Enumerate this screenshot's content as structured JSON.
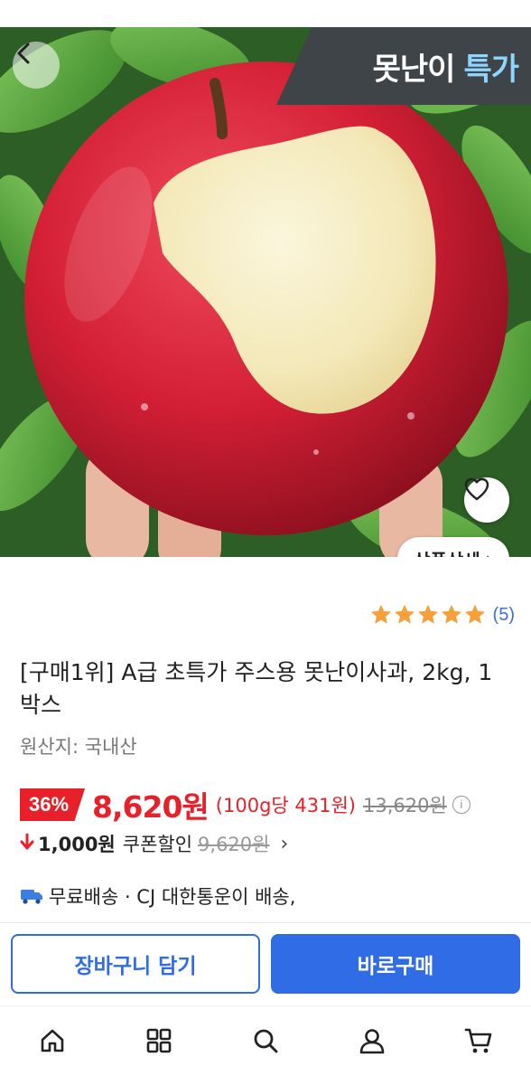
{
  "hero": {
    "banner_text_1": "못난이",
    "banner_text_2": "특가",
    "detail_button_label": "상품상세",
    "detail_button_chevron": "›"
  },
  "rating": {
    "stars": 5,
    "count": "(5)"
  },
  "product": {
    "title": "[구매1위] A급 초특가 주스용 못난이사과, 2kg, 1박스",
    "origin": "원산지: 국내산"
  },
  "price": {
    "discount": "36%",
    "sale_price": "8,620원",
    "unit_price": "(100g당 431원)",
    "original_price": "13,620원",
    "info_icon": "i"
  },
  "coupon": {
    "arrow": "🠗",
    "amount": "1,000원",
    "label": "쿠폰할인",
    "final_price": "9,620원",
    "chevron": "›"
  },
  "shipping": {
    "text": "무료배송 · CJ 대한통운이 배송,"
  },
  "actions": {
    "cart_label": "장바구니 담기",
    "buy_label": "바로구매"
  },
  "nav": {
    "items": [
      "home-icon",
      "grid-icon",
      "search-icon",
      "user-icon",
      "cart-icon"
    ]
  },
  "colors": {
    "accent_blue": "#2f6ce5",
    "sale_red": "#e8202a",
    "star_orange": "#f5a03a",
    "banner_bg": "#3f4448",
    "banner_highlight": "#8fd6ff"
  }
}
